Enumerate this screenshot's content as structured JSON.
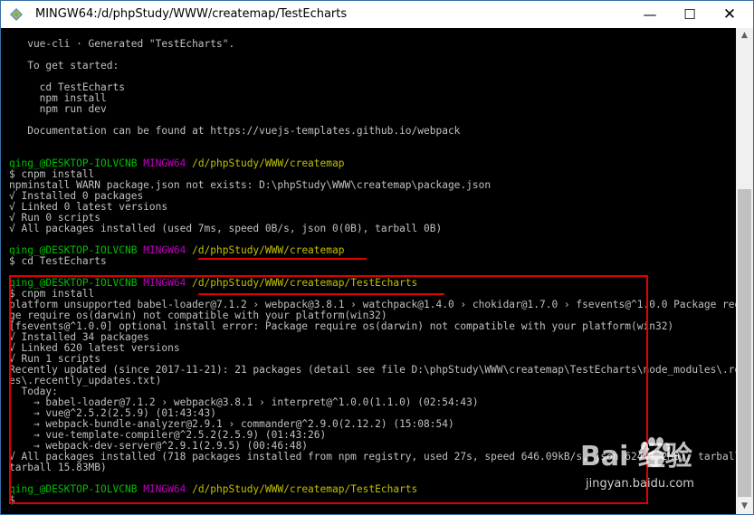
{
  "window": {
    "title": "MINGW64:/d/phpStudy/WWW/createmap/TestEcharts",
    "minimize_glyph": "—",
    "maximize_glyph": "☐",
    "close_glyph": "✕"
  },
  "terminal": {
    "lines": [
      {
        "segments": [
          {
            "t": "   vue-cli · Generated \"TestEcharts\".",
            "c": "w"
          }
        ]
      },
      {
        "segments": []
      },
      {
        "segments": [
          {
            "t": "   To get started:",
            "c": "w"
          }
        ]
      },
      {
        "segments": []
      },
      {
        "segments": [
          {
            "t": "     cd TestEcharts",
            "c": "w"
          }
        ]
      },
      {
        "segments": [
          {
            "t": "     npm install",
            "c": "w"
          }
        ]
      },
      {
        "segments": [
          {
            "t": "     npm run dev",
            "c": "w"
          }
        ]
      },
      {
        "segments": []
      },
      {
        "segments": [
          {
            "t": "   Documentation can be found at https://vuejs-templates.github.io/webpack",
            "c": "w"
          }
        ]
      },
      {
        "segments": []
      },
      {
        "segments": []
      },
      {
        "segments": [
          {
            "t": "qing_@DESKTOP-IOLVCNB ",
            "c": "g"
          },
          {
            "t": "MINGW64 ",
            "c": "m"
          },
          {
            "t": "/d/phpStudy/WWW/createmap",
            "c": "y"
          }
        ]
      },
      {
        "segments": [
          {
            "t": "$ cnpm install",
            "c": "w"
          }
        ]
      },
      {
        "segments": [
          {
            "t": "npminstall WARN package.json not exists: D:\\phpStudy\\WWW\\createmap\\package.json",
            "c": "w"
          }
        ]
      },
      {
        "segments": [
          {
            "t": "√ Installed 0 packages",
            "c": "w"
          }
        ]
      },
      {
        "segments": [
          {
            "t": "√ Linked 0 latest versions",
            "c": "w"
          }
        ]
      },
      {
        "segments": [
          {
            "t": "√ Run 0 scripts",
            "c": "w"
          }
        ]
      },
      {
        "segments": [
          {
            "t": "√ All packages installed (used 7ms, speed 0B/s, json 0(0B), tarball 0B)",
            "c": "w"
          }
        ]
      },
      {
        "segments": []
      },
      {
        "segments": [
          {
            "t": "qing_@DESKTOP-IOLVCNB ",
            "c": "g"
          },
          {
            "t": "MINGW64 ",
            "c": "m"
          },
          {
            "t": "/d/phpStudy/WWW/createmap",
            "c": "y"
          }
        ]
      },
      {
        "segments": [
          {
            "t": "$ cd TestEcharts",
            "c": "w"
          }
        ]
      },
      {
        "segments": []
      },
      {
        "segments": [
          {
            "t": "qing_@DESKTOP-IOLVCNB ",
            "c": "g"
          },
          {
            "t": "MINGW64 ",
            "c": "m"
          },
          {
            "t": "/d/phpStudy/WWW/createmap/TestEcharts",
            "c": "y"
          }
        ]
      },
      {
        "segments": [
          {
            "t": "$ cnpm install",
            "c": "w"
          }
        ]
      },
      {
        "segments": [
          {
            "t": "platform unsupported babel-loader@7.1.2 › webpack@3.8.1 › watchpack@1.4.0 › chokidar@1.7.0 › fsevents@^1.0.0 Package require os(darwin) not compatible with your platform(win32)",
            "c": "w"
          }
        ]
      },
      {
        "segments": [
          {
            "t": "ge require os(darwin) not compatible with your platform(win32)",
            "c": "w"
          }
        ]
      },
      {
        "segments": [
          {
            "t": "[fsevents@^1.0.0] optional install error: Package require os(darwin) not compatible with your platform(win32)",
            "c": "w"
          }
        ]
      },
      {
        "segments": [
          {
            "t": "√ Installed 34 packages",
            "c": "w"
          }
        ]
      },
      {
        "segments": [
          {
            "t": "√ Linked 620 latest versions",
            "c": "w"
          }
        ]
      },
      {
        "segments": [
          {
            "t": "√ Run 1 scripts",
            "c": "w"
          }
        ]
      },
      {
        "segments": [
          {
            "t": "Recently updated (since 2017-11-21): 21 packages (detail see file D:\\phpStudy\\WWW\\createmap\\TestEcharts\\node_modules\\.recently_updates.txt)",
            "c": "w"
          }
        ]
      },
      {
        "segments": [
          {
            "t": "es\\.recently_updates.txt)",
            "c": "w"
          }
        ]
      },
      {
        "segments": [
          {
            "t": "  Today:",
            "c": "w"
          }
        ]
      },
      {
        "segments": [
          {
            "t": "    → babel-loader@7.1.2 › webpack@3.8.1 › interpret@^1.0.0(1.1.0) (02:54:43)",
            "c": "w"
          }
        ]
      },
      {
        "segments": [
          {
            "t": "    → vue@^2.5.2(2.5.9) (01:43:43)",
            "c": "w"
          }
        ]
      },
      {
        "segments": [
          {
            "t": "    → webpack-bundle-analyzer@2.9.1 › commander@^2.9.0(2.12.2) (15:08:54)",
            "c": "w"
          }
        ]
      },
      {
        "segments": [
          {
            "t": "    → vue-template-compiler@^2.5.2(2.5.9) (01:43:26)",
            "c": "w"
          }
        ]
      },
      {
        "segments": [
          {
            "t": "    → webpack-dev-server@^2.9.1(2.9.5) (00:46:48)",
            "c": "w"
          }
        ]
      },
      {
        "segments": [
          {
            "t": "√ All packages installed (718 packages installed from npm registry, used 27s, speed 646.09kB/s, json 624(1.2MB), tarball 15.83MB)",
            "c": "w"
          }
        ]
      },
      {
        "segments": [
          {
            "t": "tarball 15.83MB)",
            "c": "w"
          }
        ]
      },
      {
        "segments": []
      },
      {
        "segments": [
          {
            "t": "qing_@DESKTOP-IOLVCNB ",
            "c": "g"
          },
          {
            "t": "MINGW64 ",
            "c": "m"
          },
          {
            "t": "/d/phpStudy/WWW/createmap/TestEcharts",
            "c": "y"
          }
        ]
      },
      {
        "segments": [
          {
            "t": "$",
            "c": "w"
          }
        ]
      }
    ]
  },
  "scrollbar": {
    "up_glyph": "▲",
    "down_glyph": "▼"
  },
  "watermark": {
    "logo_text": "Bai  经验",
    "sub_text": "jingyan.baidu.com"
  },
  "colors": {
    "prompt_user": "#00c000",
    "prompt_host": "#c000c0",
    "prompt_path": "#c0c000",
    "annotation": "#e00000"
  }
}
